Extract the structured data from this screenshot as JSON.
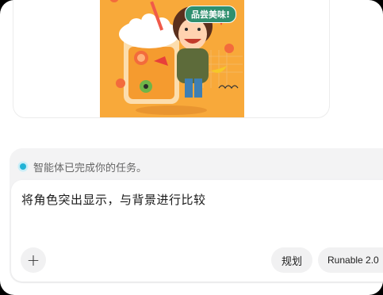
{
  "image_card": {
    "bubble_text": "品尝美味!",
    "background_color": "#f8a93a"
  },
  "status": {
    "text": "智能体已完成你的任务。",
    "dot_color": "#22b3d6"
  },
  "composer": {
    "input_value": "将角色突出显示，与背景进行比较",
    "add_label": "+",
    "plan_label": "规划",
    "model_label": "Runable 2.0"
  }
}
